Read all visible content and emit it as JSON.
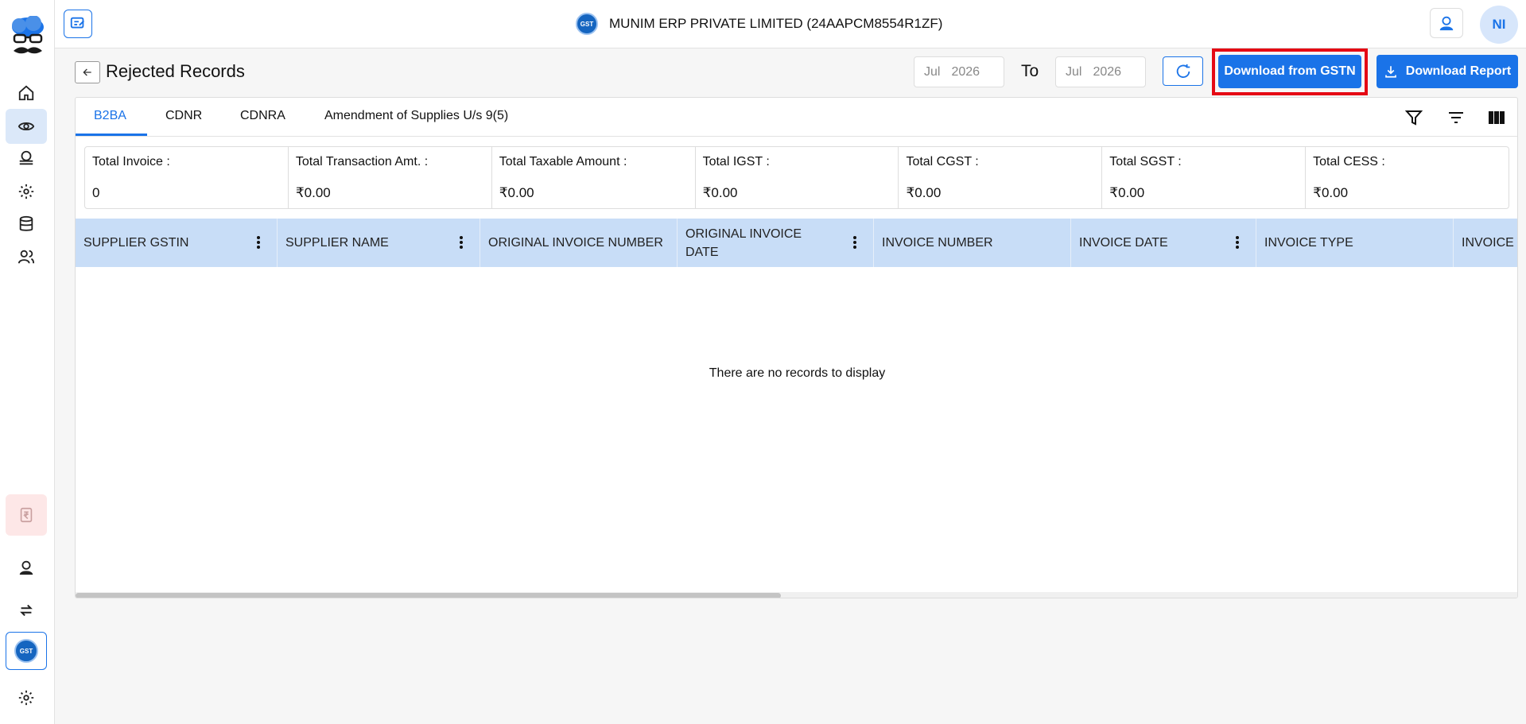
{
  "header": {
    "company": "MUNIM ERP PRIVATE LIMITED (24AAPCM8554R1ZF)",
    "gst_badge": "GST",
    "avatar_initials": "NI"
  },
  "page": {
    "title": "Rejected Records",
    "from_month": "Jul",
    "from_year": "2026",
    "to_label": "To",
    "to_month": "Jul",
    "to_year": "2026",
    "download_gstn_label": "Download from GSTN",
    "download_report_label": "Download Report"
  },
  "tabs": [
    {
      "label": "B2BA",
      "active": true
    },
    {
      "label": "CDNR",
      "active": false
    },
    {
      "label": "CDNRA",
      "active": false
    },
    {
      "label": "Amendment of Supplies U/s 9(5)",
      "active": false
    }
  ],
  "summary": [
    {
      "label": "Total Invoice :",
      "value": "0"
    },
    {
      "label": "Total Transaction Amt. :",
      "value": "₹0.00"
    },
    {
      "label": "Total Taxable Amount :",
      "value": "₹0.00"
    },
    {
      "label": "Total IGST :",
      "value": "₹0.00"
    },
    {
      "label": "Total CGST :",
      "value": "₹0.00"
    },
    {
      "label": "Total SGST :",
      "value": "₹0.00"
    },
    {
      "label": "Total CESS :",
      "value": "₹0.00"
    }
  ],
  "columns": [
    "SUPPLIER GSTIN",
    "SUPPLIER NAME",
    "ORIGINAL INVOICE NUMBER",
    "ORIGINAL INVOICE DATE",
    "INVOICE NUMBER",
    "INVOICE DATE",
    "INVOICE TYPE",
    "INVOICE"
  ],
  "empty_message": "There are no records to display",
  "sidebar": {
    "rupee_icon": "rupee-icon",
    "gst_icon": "GST"
  },
  "colors": {
    "accent": "#1a73e8",
    "highlight_outline": "#e50914",
    "table_header": "#c8ddf7"
  }
}
